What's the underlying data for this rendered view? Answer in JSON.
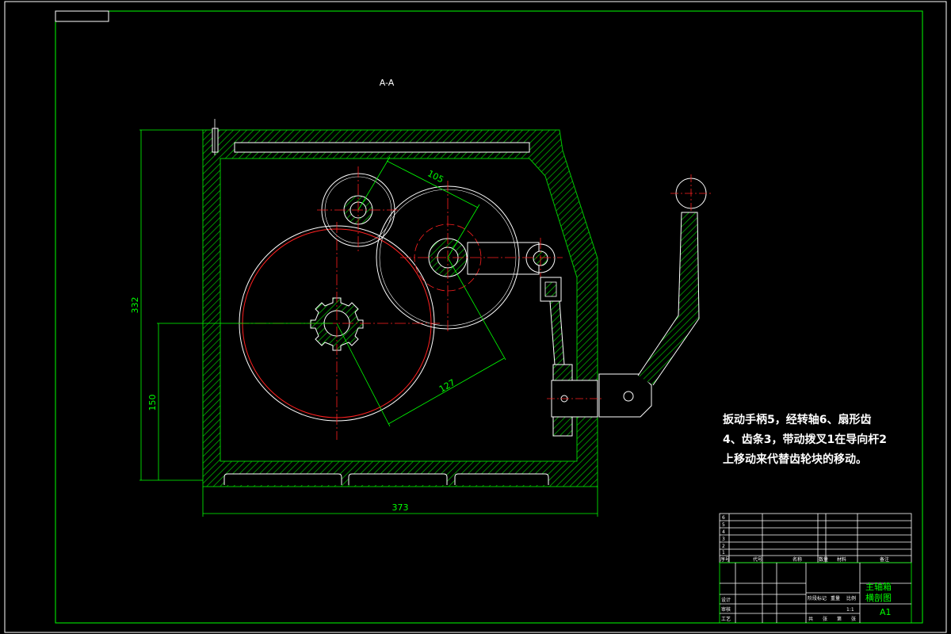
{
  "drawing": {
    "section_label": "A-A",
    "note": "扳动手柄5，经转轴6、扇形齿4、齿条3，带动拨叉1在导向杆2上移动来代替齿轮块的移动。"
  },
  "dimensions": {
    "overall_height": "332",
    "lower_height": "150",
    "overall_width": "373",
    "center_distance_upper": "105",
    "center_distance_lower": "127"
  },
  "title_block": {
    "drawing_name_line1": "主轴箱",
    "drawing_name_line2": "横剖图",
    "sheet_size": "A1",
    "parts_rows": [
      "6",
      "5",
      "4",
      "3",
      "2",
      "1"
    ],
    "header_labels": [
      "序号",
      "代号",
      "名称",
      "数量",
      "材料",
      "备注"
    ],
    "sign_labels": [
      "设计",
      "审核",
      "工艺"
    ],
    "scale_labels": [
      "阶段标记",
      "重量",
      "比例"
    ],
    "scale_value": "1:1",
    "sheet_labels": [
      "共",
      "张",
      "第",
      "张"
    ]
  },
  "colors": {
    "frame": "#00ff00",
    "housing": "#00c800",
    "part_outline": "#ffffff",
    "center_line": "#ff0000",
    "dimension": "#00ff00",
    "gear_root": "#ff2020"
  }
}
